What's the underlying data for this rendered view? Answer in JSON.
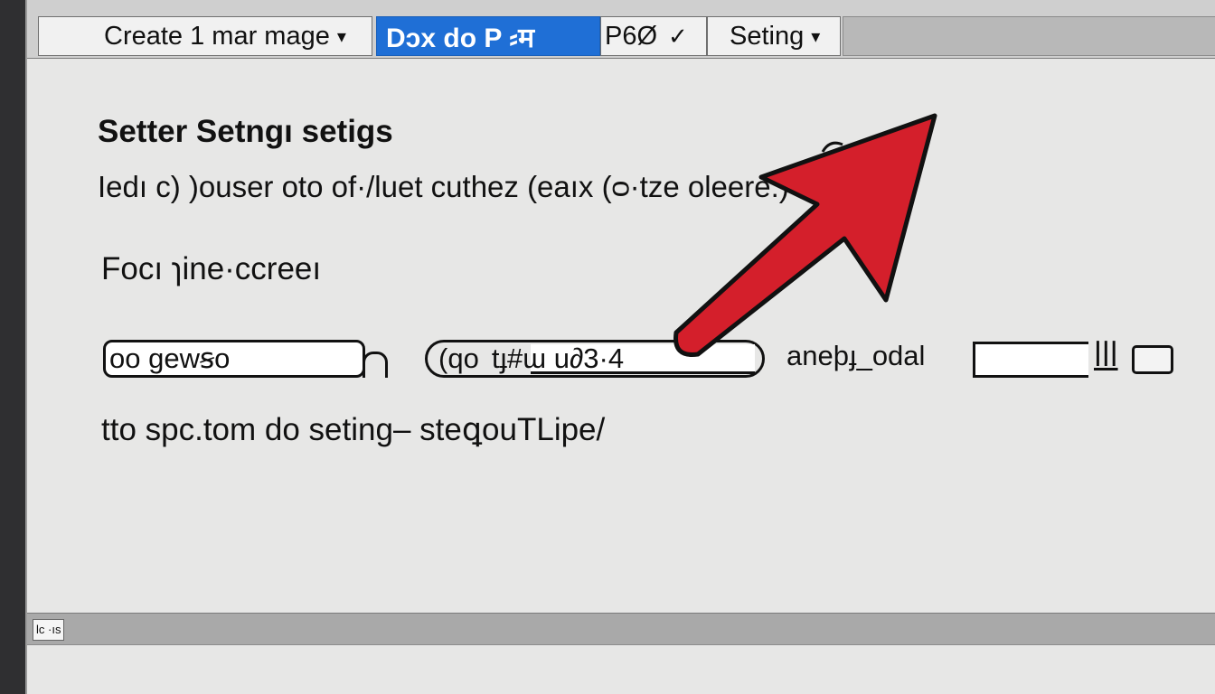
{
  "menubar": {
    "menus": [
      {
        "label": "Create 1 mar mage",
        "caret": "▾"
      },
      {
        "label": "Dɔx do P ⸗म",
        "highlighted": true
      },
      {
        "label": "P6Ø",
        "check": "✓"
      },
      {
        "label": "Seting",
        "caret": "▾"
      }
    ]
  },
  "panel": {
    "heading": "Setter Setngı  setigs",
    "description": "Iedı c) )ouser oto of·/luet cuthez (eaıx (ᴑ·tze         oleere:)",
    "focus_label": "Focı ɿine·ccreeı",
    "fields": [
      {
        "value": "oo gewꞩo"
      },
      {
        "prefix": "(qo",
        "value": "tɟ#ɯ u∂3·4"
      },
      {
        "label": "aneþɟ_odal",
        "suffix": "ꟾꟾꟾ"
      }
    ],
    "footer_text": "tto  spc.tom do seting–  steꝗouTLipe/"
  },
  "statusbar": {
    "label": "lc ·ıs"
  },
  "colors": {
    "accent": "#1f6fd6",
    "arrow": "#d41f2b"
  },
  "icons": {
    "pointer": "red-arrow-icon",
    "dropdown": "chevron-down-icon",
    "check": "check-icon"
  }
}
